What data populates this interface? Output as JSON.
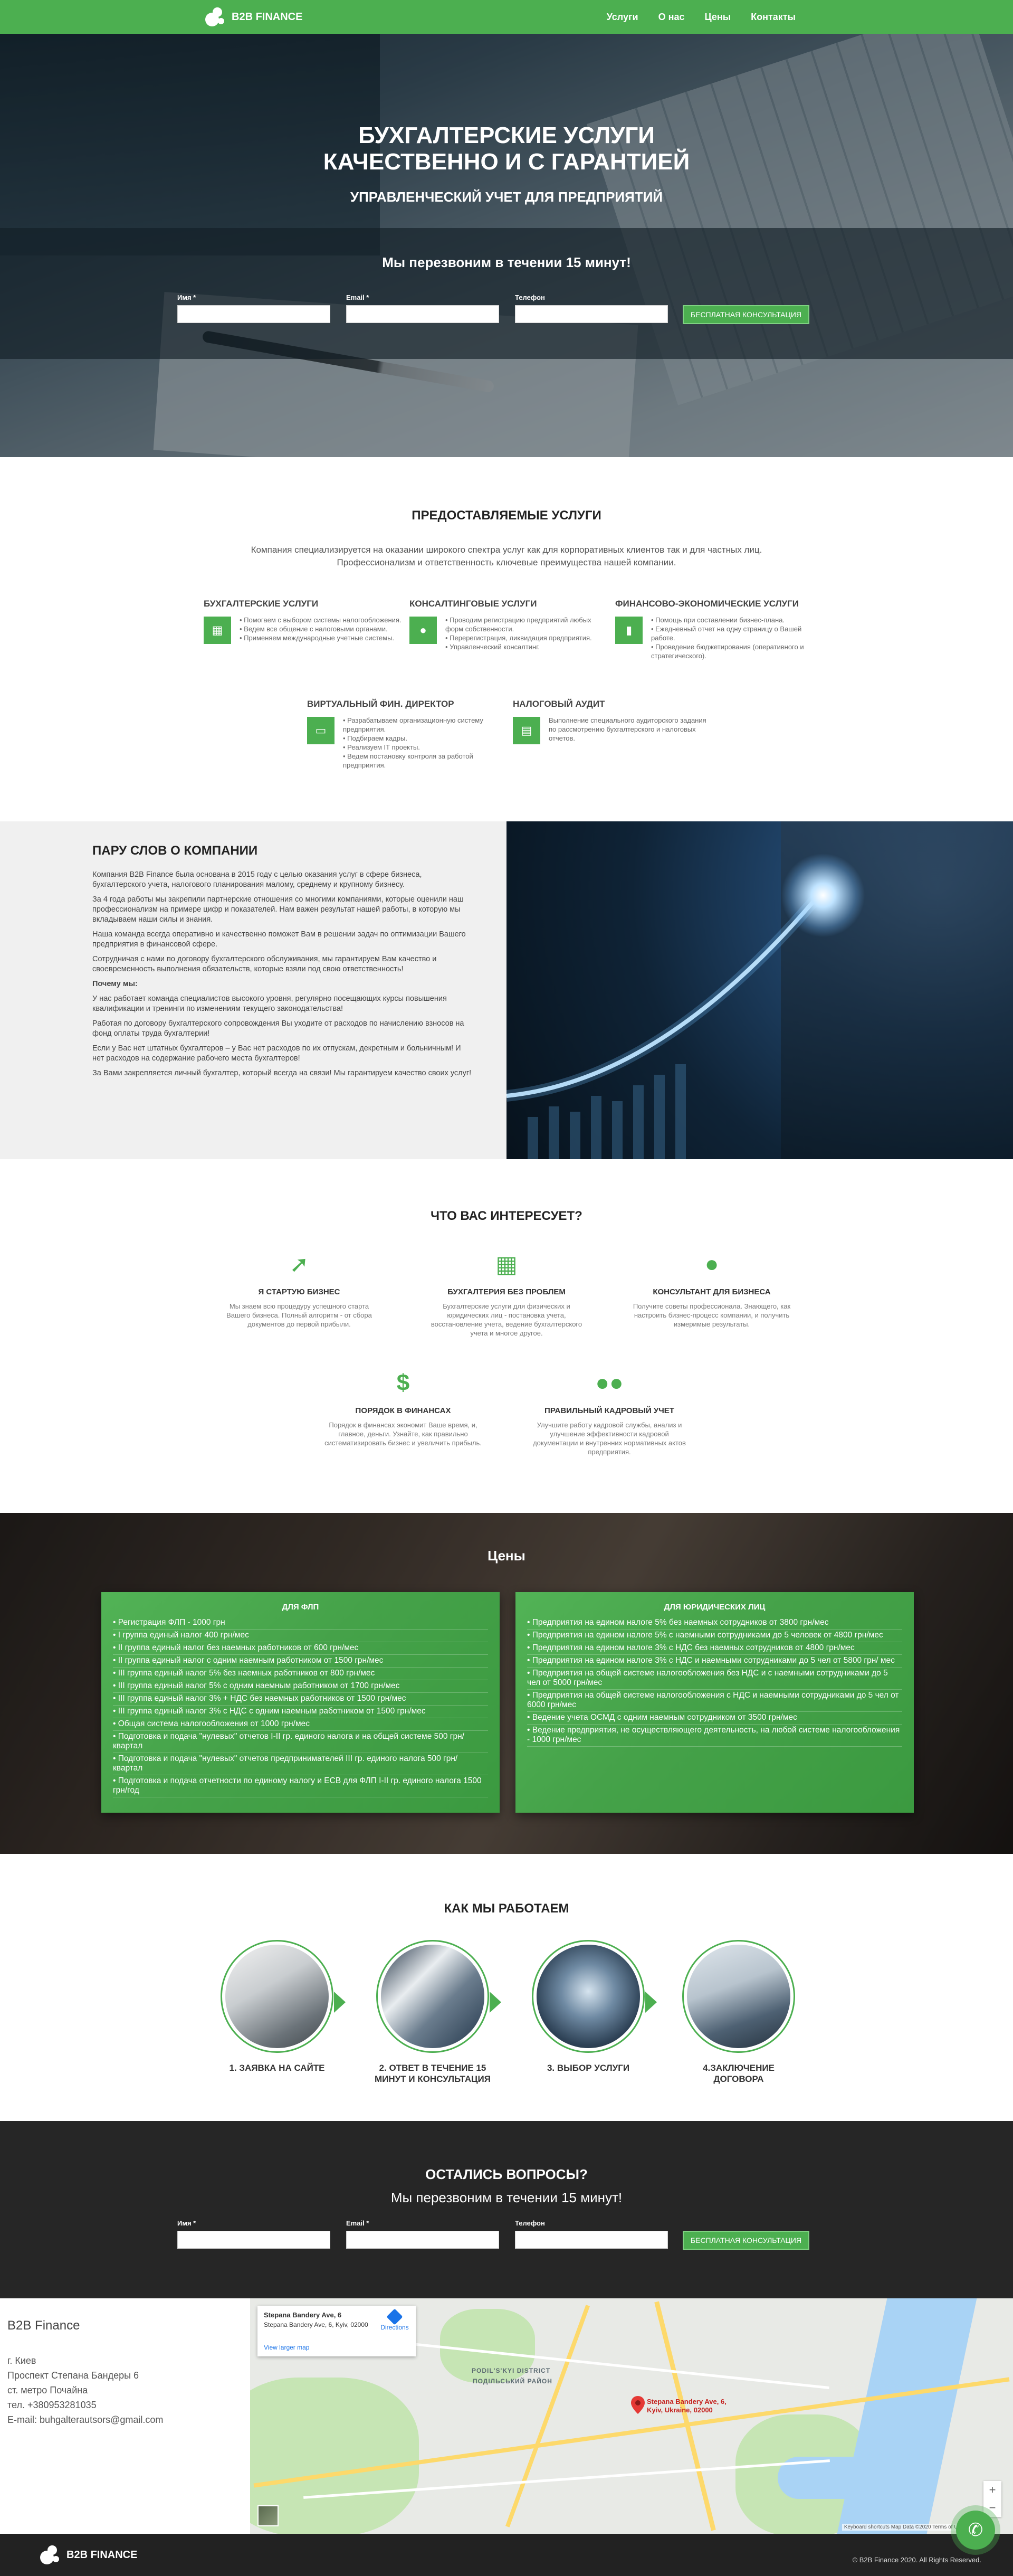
{
  "header": {
    "logo_text": "B2B FINANCE",
    "nav": [
      "Услуги",
      "О нас",
      "Цены",
      "Контакты"
    ]
  },
  "hero": {
    "title_line1": "БУХГАЛТЕРСКИЕ УСЛУГИ",
    "title_line2": "КАЧЕСТВЕННО И С ГАРАНТИЕЙ",
    "subtitle": "УПРАВЛЕНЧЕСКИЙ УЧЕТ ДЛЯ ПРЕДПРИЯТИЙ",
    "callback": "Мы перезвоним в течении 15 минут!",
    "form": {
      "name_label": "Имя *",
      "email_label": "Email *",
      "phone_label": "Телефон",
      "button": "БЕСПЛАТНАЯ КОНСУЛЬТАЦИЯ"
    }
  },
  "services": {
    "title": "ПРЕДОСТАВЛЯЕМЫЕ УСЛУГИ",
    "desc_line1": "Компания специализируется на оказании широкого спектра услуг как для корпоративных клиентов так и для частных лиц.",
    "desc_line2": "Профессионализм и ответственность ключевые преимущества нашей компании.",
    "items": [
      {
        "title": "БУХГАЛТЕРСКИЕ УСЛУГИ",
        "icon": "calculator-icon",
        "lines": [
          "• Помогаем с выбором системы налогообложения.",
          "• Ведем все общение с налоговыми органами.",
          "• Применяем международные учетные системы."
        ]
      },
      {
        "title": "КОНСАЛТИНГОВЫЕ УСЛУГИ",
        "icon": "user-icon",
        "lines": [
          "• Проводим регистрацию предприятий любых форм собственности.",
          "• Перерегистрация, ликвидация предприятия.",
          "• Управленческий консалтинг."
        ]
      },
      {
        "title": "ФИНАНСОВО-ЭКОНОМИЧЕСКИЕ УСЛУГИ",
        "icon": "chart-icon",
        "lines": [
          "• Помощь при составлении бизнес-плана.",
          "• Ежедневный отчет на одну страницу о Вашей работе.",
          "• Проведение бюджетирования (оперативного и стратегического)."
        ]
      },
      {
        "title": "ВИРТУАЛЬНЫЙ ФИН. ДИРЕКТОР",
        "icon": "laptop-icon",
        "lines": [
          "• Разрабатываем организационную систему предприятия.",
          "• Подбираем кадры.",
          "• Реализуем IT проекты.",
          "• Ведем постановку контроля за работой предприятия."
        ]
      },
      {
        "title": "НАЛОГОВЫЙ АУДИТ",
        "icon": "document-icon",
        "lines": [
          "Выполнение специального аудиторского задания по рассмотрению бухгалтерского и налоговых отчетов."
        ]
      }
    ]
  },
  "about": {
    "title": "ПАРУ СЛОВ О КОМПАНИИ",
    "paragraphs": [
      "Компания B2B Finance была основана в 2015 году с целью оказания услуг в сфере бизнеса, бухгалтерского учета, налогового планирования малому, среднему и крупному бизнесу.",
      "За 4 года работы мы закрепили партнерские отношения со многими компаниями, которые оценили наш профессионализм на примере цифр и показателей. Нам важен результат нашей работы, в которую мы вкладываем наши силы и знания.",
      "Наша команда всегда оперативно и качественно поможет Вам в решении задач по оптимизации Вашего предприятия в финансовой сфере.",
      "Сотрудничая с нами по договору бухгалтерского обслуживания, мы гарантируем Вам качество и своевременность выполнения обязательств, которые взяли под свою ответственность!",
      "Почему мы:",
      "У нас работает команда специалистов высокого уровня, регулярно посещающих курсы повышения квалификации и тренинги по изменениям текущего законодательства!",
      "Работая по договору бухгалтерского сопровождения Вы уходите от расходов по начислению взносов на фонд оплаты труда бухгалтерии!",
      "Если у Вас нет штатных бухгалтеров – у Вас нет расходов по их отпускам, декретным и больничным! И нет расходов на содержание рабочего места бухгалтеров!",
      "За Вами закрепляется личный бухгалтер, который всегда на связи! Мы гарантируем качество своих услуг!"
    ]
  },
  "interests": {
    "title": "ЧТО ВАС ИНТЕРЕСУЕТ?",
    "items": [
      {
        "title": "Я СТАРТУЮ БИЗНЕС",
        "icon": "rocket-icon",
        "text": "Мы знаем всю процедуру успешного старта Вашего бизнеса. Полный алгоритм - от сбора документов до первой прибыли."
      },
      {
        "title": "БУХГАЛТЕРИЯ БЕЗ ПРОБЛЕМ",
        "icon": "calculator-icon",
        "text": "Бухгалтерские услуги для физических и юридических лиц - постановка учета, восстановление учета, ведение бухгалтерского учета и многое другое."
      },
      {
        "title": "КОНСУЛЬТАНТ ДЛЯ БИЗНЕСА",
        "icon": "user-icon",
        "text": "Получите советы профессионала. Знающего, как настроить бизнес-процесс компании, и получить измеримые результаты."
      },
      {
        "title": "ПОРЯДОК В ФИНАНСАХ",
        "icon": "dollar-icon",
        "text": "Порядок в финансах экономит Ваше время, и, главное, деньги. Узнайте, как правильно систематизировать бизнес и увеличить прибыль."
      },
      {
        "title": "ПРАВИЛЬНЫЙ КАДРОВЫЙ УЧЕТ",
        "icon": "group-icon",
        "text": "Улучшите работу кадровой службы, анализ и улучшение эффективности кадровой документации и внутренних нормативных актов предприятия."
      }
    ]
  },
  "prices": {
    "title": "Цены",
    "fop": {
      "title": "ДЛЯ ФЛП",
      "items": [
        "• Регистрация ФЛП - 1000 грн",
        "• I группа единый налог 400 грн/мес",
        "• II группа единый налог без наемных работников от 600 грн/мес",
        "• II группа единый налог с одним наемным работником от 1500 грн/мес",
        "• III группа единый налог 5% без наемных работников от 800 грн/мес",
        "• III группа единый налог 5% с одним наемным работником от 1700 грн/мес",
        "• III группа единый налог 3% + НДС без наемных работников от 1500 грн/мес",
        "• III группа единый налог 3% с НДС с одним наемным работником от 1500 грн/мес",
        "• Общая система налогообложения от 1000 грн/мес",
        "• Подготовка и подача \"нулевых\" отчетов I-II гр. единого налога и на общей системе 500 грн/ квартал",
        "• Подготовка и подача \"нулевых\" отчетов предпринимателей III гр. единого налога 500 грн/ квартал",
        "• Подготовка и подача отчетности по единому налогу и ЕСВ для ФЛП I-II гр. единого налога 1500 грн/год"
      ]
    },
    "legal": {
      "title": "ДЛЯ ЮРИДИЧЕСКИХ ЛИЦ",
      "items": [
        "• Предприятия на едином налоге 5% без наемных сотрудников от 3800 грн/мес",
        "• Предприятия на едином налоге 5% с наемными сотрудниками до 5 человек от 4800 грн/мес",
        "• Предприятия на едином налоге 3% с НДС без наемных сотрудников от 4800 грн/мес",
        "• Предприятия на едином налоге 3% с НДС и наемными сотрудниками до 5 чел от 5800 грн/ мес",
        "• Предприятия на общей системе налогообложения без НДС и с наемными сотрудниками до 5 чел от 5000 грн/мес",
        "• Предприятия на общей системе налогообложения с НДС и наемными сотрудниками до 5 чел от 6000 грн/мес",
        "• Ведение учета ОСМД с одним наемным сотрудником от 3500 грн/мес",
        "• Ведение предприятия, не осуществляющего деятельность, на любой системе налогообложения - 1000 грн/мес"
      ]
    }
  },
  "how": {
    "title": "КАК МЫ РАБОТАЕМ",
    "steps": [
      {
        "label": "1. ЗАЯВКА НА САЙТЕ"
      },
      {
        "label": "2. ОТВЕТ В ТЕЧЕНИЕ 15 МИНУТ И КОНСУЛЬТАЦИЯ"
      },
      {
        "label": "3. ВЫБОР УСЛУГИ"
      },
      {
        "label": "4.ЗАКЛЮЧЕНИЕ ДОГОВОРА"
      }
    ]
  },
  "questions": {
    "title": "ОСТАЛИСЬ ВОПРОСЫ?",
    "subtitle": "Мы перезвоним в течении 15 минут!",
    "form": {
      "name_label": "Имя *",
      "email_label": "Email *",
      "phone_label": "Телефон",
      "button": "БЕСПЛАТНАЯ КОНСУЛЬТАЦИЯ"
    }
  },
  "contacts": {
    "brand": "B2B Finance",
    "lines": [
      "г. Киев",
      "Проспект Степана Бандеры 6",
      "ст. метро Почайна",
      "тел. +380953281035",
      "E-mail: buhgalterautsors@gmail.com"
    ]
  },
  "map": {
    "info_title": "Stepana Bandery Ave, 6",
    "info_address": "Stepana Bandery Ave, 6, Kyiv, 02000",
    "directions": "Directions",
    "view_larger": "View larger map",
    "pin_label": "Stepana Bandery Ave, 6, Kyiv, Ukraine, 02000",
    "district_label": "PODIL'S'KYI DISTRICT",
    "district_local": "ПОДІЛЬСЬКИЙ РАЙОН",
    "attribution": "Keyboard shortcuts   Map Data ©2020   Terms of Use"
  },
  "footer": {
    "logo_text": "B2B FINANCE",
    "copyright": "© B2B Finance 2020. All Rights Reserved."
  },
  "colors": {
    "accent": "#4caf50",
    "dark": "#262626"
  }
}
